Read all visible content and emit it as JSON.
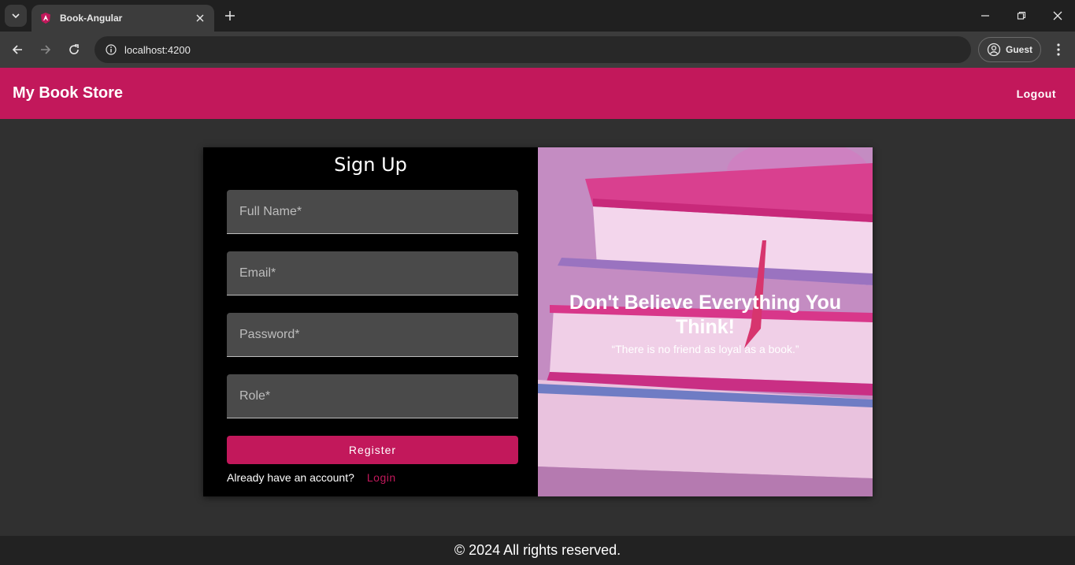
{
  "browser": {
    "tab_title": "Book-Angular",
    "url": "localhost:4200",
    "profile_label": "Guest"
  },
  "toolbar": {
    "brand": "My Book Store",
    "logout_label": "Logout"
  },
  "signup": {
    "title": "Sign Up",
    "fields": [
      {
        "placeholder": "Full Name*",
        "value": ""
      },
      {
        "placeholder": "Email*",
        "value": ""
      },
      {
        "placeholder": "Password*",
        "value": ""
      },
      {
        "placeholder": "Role*",
        "value": ""
      }
    ],
    "register_label": "Register",
    "already_text": "Already have an account?",
    "login_label": "Login"
  },
  "hero": {
    "headline": "Don't Believe Everything You Think!",
    "quote": "“There is no friend as loyal as a book.”"
  },
  "footer": {
    "copyright": "© 2024 All rights reserved."
  },
  "colors": {
    "accent": "#c2185b",
    "background": "#303030"
  }
}
